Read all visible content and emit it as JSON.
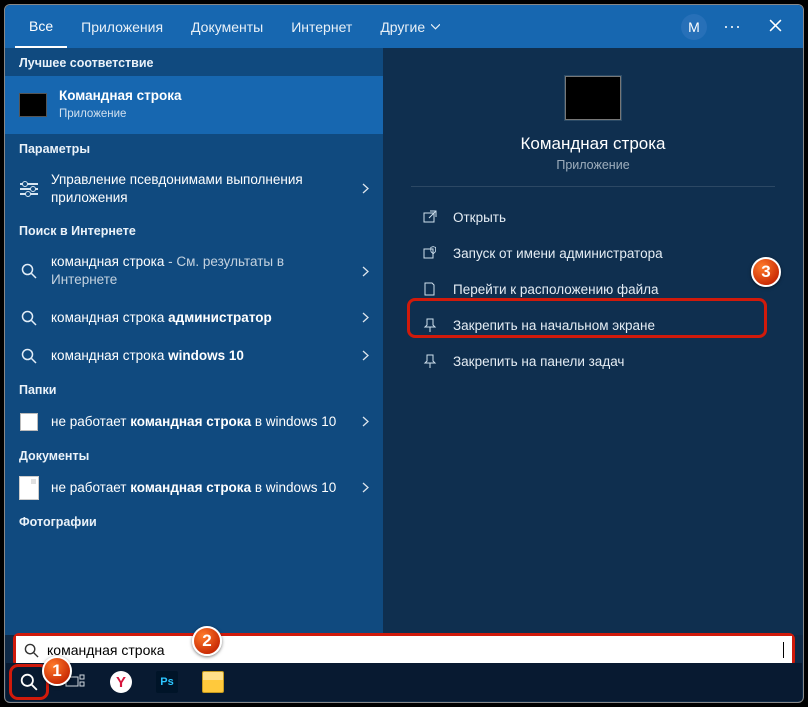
{
  "tabs": {
    "all": "Все",
    "apps": "Приложения",
    "docs": "Документы",
    "internet": "Интернет",
    "other": "Другие"
  },
  "account_letter": "M",
  "sections": {
    "best": "Лучшее соответствие",
    "params": "Параметры",
    "web": "Поиск в Интернете",
    "folders": "Папки",
    "documents": "Документы",
    "photos": "Фотографии"
  },
  "best_match": {
    "title": "Командная строка",
    "sub": "Приложение"
  },
  "params_item_pre": "Управление псевдонимами ",
  "params_item_post": "выполнения приложения",
  "web1_pre": "командная строка",
  "web1_post": " - См. результаты в Интернете",
  "web2_pre": "командная строка ",
  "web2_bold": "администратор",
  "web3_pre": "командная строка ",
  "web3_bold": "windows 10",
  "folder_pre": "не работает ",
  "folder_bold": "командная строка",
  "folder_post": " в windows 10",
  "doc_pre": "не работает ",
  "doc_bold": "командная строка",
  "doc_post": " в windows 10",
  "preview": {
    "title": "Командная строка",
    "sub": "Приложение"
  },
  "actions": {
    "open": "Открыть",
    "runas": "Запуск от имени администратора",
    "location": "Перейти к расположению файла",
    "pin_start": "Закрепить на начальном экране",
    "pin_task": "Закрепить на панели задач"
  },
  "search_value": "командная строка",
  "badges": {
    "b1": "1",
    "b2": "2",
    "b3": "3"
  }
}
